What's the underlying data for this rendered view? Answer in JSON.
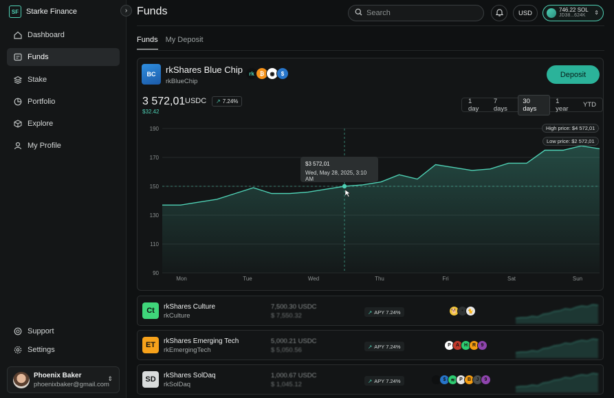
{
  "brand": {
    "name": "Starke Finance",
    "logo_text": "SF"
  },
  "sidebar": {
    "items": [
      {
        "label": "Dashboard",
        "icon": "dashboard-icon"
      },
      {
        "label": "Funds",
        "icon": "funds-icon",
        "active": true
      },
      {
        "label": "Stake",
        "icon": "stake-icon"
      },
      {
        "label": "Portfolio",
        "icon": "portfolio-icon"
      },
      {
        "label": "Explore",
        "icon": "explore-icon"
      },
      {
        "label": "My Profile",
        "icon": "profile-icon"
      }
    ],
    "bottom": [
      {
        "label": "Support",
        "icon": "support-icon"
      },
      {
        "label": "Settings",
        "icon": "settings-icon"
      }
    ],
    "user": {
      "name": "Phoenix Baker",
      "email": "phoenixbaker@gmail.com"
    }
  },
  "header": {
    "title": "Funds",
    "search_placeholder": "Search",
    "currency": "USD",
    "wallet": {
      "balance": "746.22 SOL",
      "address": "JD38...624K"
    }
  },
  "tabs": [
    "Funds",
    "My Deposit"
  ],
  "fund": {
    "name": "rkShares Blue Chip",
    "ticker": "rkBlueChip",
    "logo_text": "BC",
    "deposit_label": "Deposit",
    "price": "3 572,01",
    "price_currency": "USDC",
    "change": "7.24%",
    "delta": "$32.42",
    "ranges": [
      "1 day",
      "7 days",
      "30 days",
      "1 year",
      "YTD"
    ],
    "active_range": "30 days",
    "assets": [
      {
        "name": "rk",
        "color": "#0e1011",
        "fg": "#4fd1b5",
        "glyph": "rk"
      },
      {
        "name": "bitcoin",
        "color": "#f7931a",
        "fg": "#ffffff",
        "glyph": "₿"
      },
      {
        "name": "ethena",
        "color": "#ffffff",
        "fg": "#111111",
        "glyph": "◉"
      },
      {
        "name": "usdc",
        "color": "#2775ca",
        "fg": "#ffffff",
        "glyph": "$"
      }
    ]
  },
  "chart_data": {
    "type": "area",
    "x": [
      "Mon",
      "Tue",
      "Wed",
      "Thu",
      "Fri",
      "Sat",
      "Sun"
    ],
    "ylim": [
      90,
      190
    ],
    "yticks": [
      90,
      110,
      130,
      150,
      170,
      190
    ],
    "values": [
      137,
      137,
      139,
      141,
      145,
      149,
      145,
      145,
      146,
      148,
      150,
      151,
      153,
      158,
      155,
      165,
      163,
      161,
      162,
      166,
      166,
      175,
      175,
      178,
      176
    ],
    "reference_line": 150,
    "tooltip": {
      "price": "$3 572,01",
      "date": "Wed, May 28, 2025, 3:10 AM"
    },
    "high_label": "High price: $4 572,01",
    "low_label": "Low price: $2 572,01",
    "color": "#4fd1b5"
  },
  "rows": [
    {
      "name": "rkShares Culture",
      "ticker": "rkCulture",
      "logo_text": "Ct",
      "logo_color": "#3fd67a",
      "value": "7,500.30 USDC",
      "usd": "$ 7,550.32",
      "apy": "APY 7.24%",
      "assets": [
        {
          "name": "doge",
          "color": "#f0c43a",
          "glyph": "🐕"
        },
        {
          "name": "bonk",
          "color": "#2d3132",
          "glyph": "•"
        },
        {
          "name": "popcat",
          "color": "#e8e8e8",
          "glyph": "🐈"
        }
      ]
    },
    {
      "name": "rkShares Emerging Tech",
      "ticker": "rkEmergingTech",
      "logo_text": "ET",
      "logo_color": "#f7a21b",
      "value": "5,000.21 USDC",
      "usd": "$ 5,050.56",
      "apy": "APY 7.24%",
      "assets": [
        {
          "name": "parcl",
          "color": "#ffffff",
          "glyph": "P"
        },
        {
          "name": "ai16z",
          "color": "#c0392b",
          "glyph": "A"
        },
        {
          "name": "helium",
          "color": "#2ecc71",
          "glyph": "H"
        },
        {
          "name": "render",
          "color": "#f39c12",
          "glyph": "R"
        },
        {
          "name": "nosana",
          "color": "#8e44ad",
          "glyph": "9"
        }
      ]
    },
    {
      "name": "rkShares SolDaq",
      "ticker": "rkSolDaq",
      "logo_text": "SD",
      "logo_color": "#d9dcdc",
      "value": "1,000.67 USDC",
      "usd": "$ 1,045.12",
      "apy": "APY 7.24%",
      "assets": [
        {
          "name": "rk",
          "color": "#0e1011",
          "glyph": "rk"
        },
        {
          "name": "usdc",
          "color": "#2775ca",
          "glyph": "$"
        },
        {
          "name": "hnt",
          "color": "#2ecc71",
          "glyph": "≋"
        },
        {
          "name": "pyth",
          "color": "#e5e5e5",
          "glyph": "P"
        },
        {
          "name": "bonk",
          "color": "#f39c12",
          "glyph": "B"
        },
        {
          "name": "jup",
          "color": "#4a4f50",
          "glyph": "J"
        },
        {
          "name": "nos",
          "color": "#8e44ad",
          "glyph": "9"
        }
      ]
    }
  ]
}
